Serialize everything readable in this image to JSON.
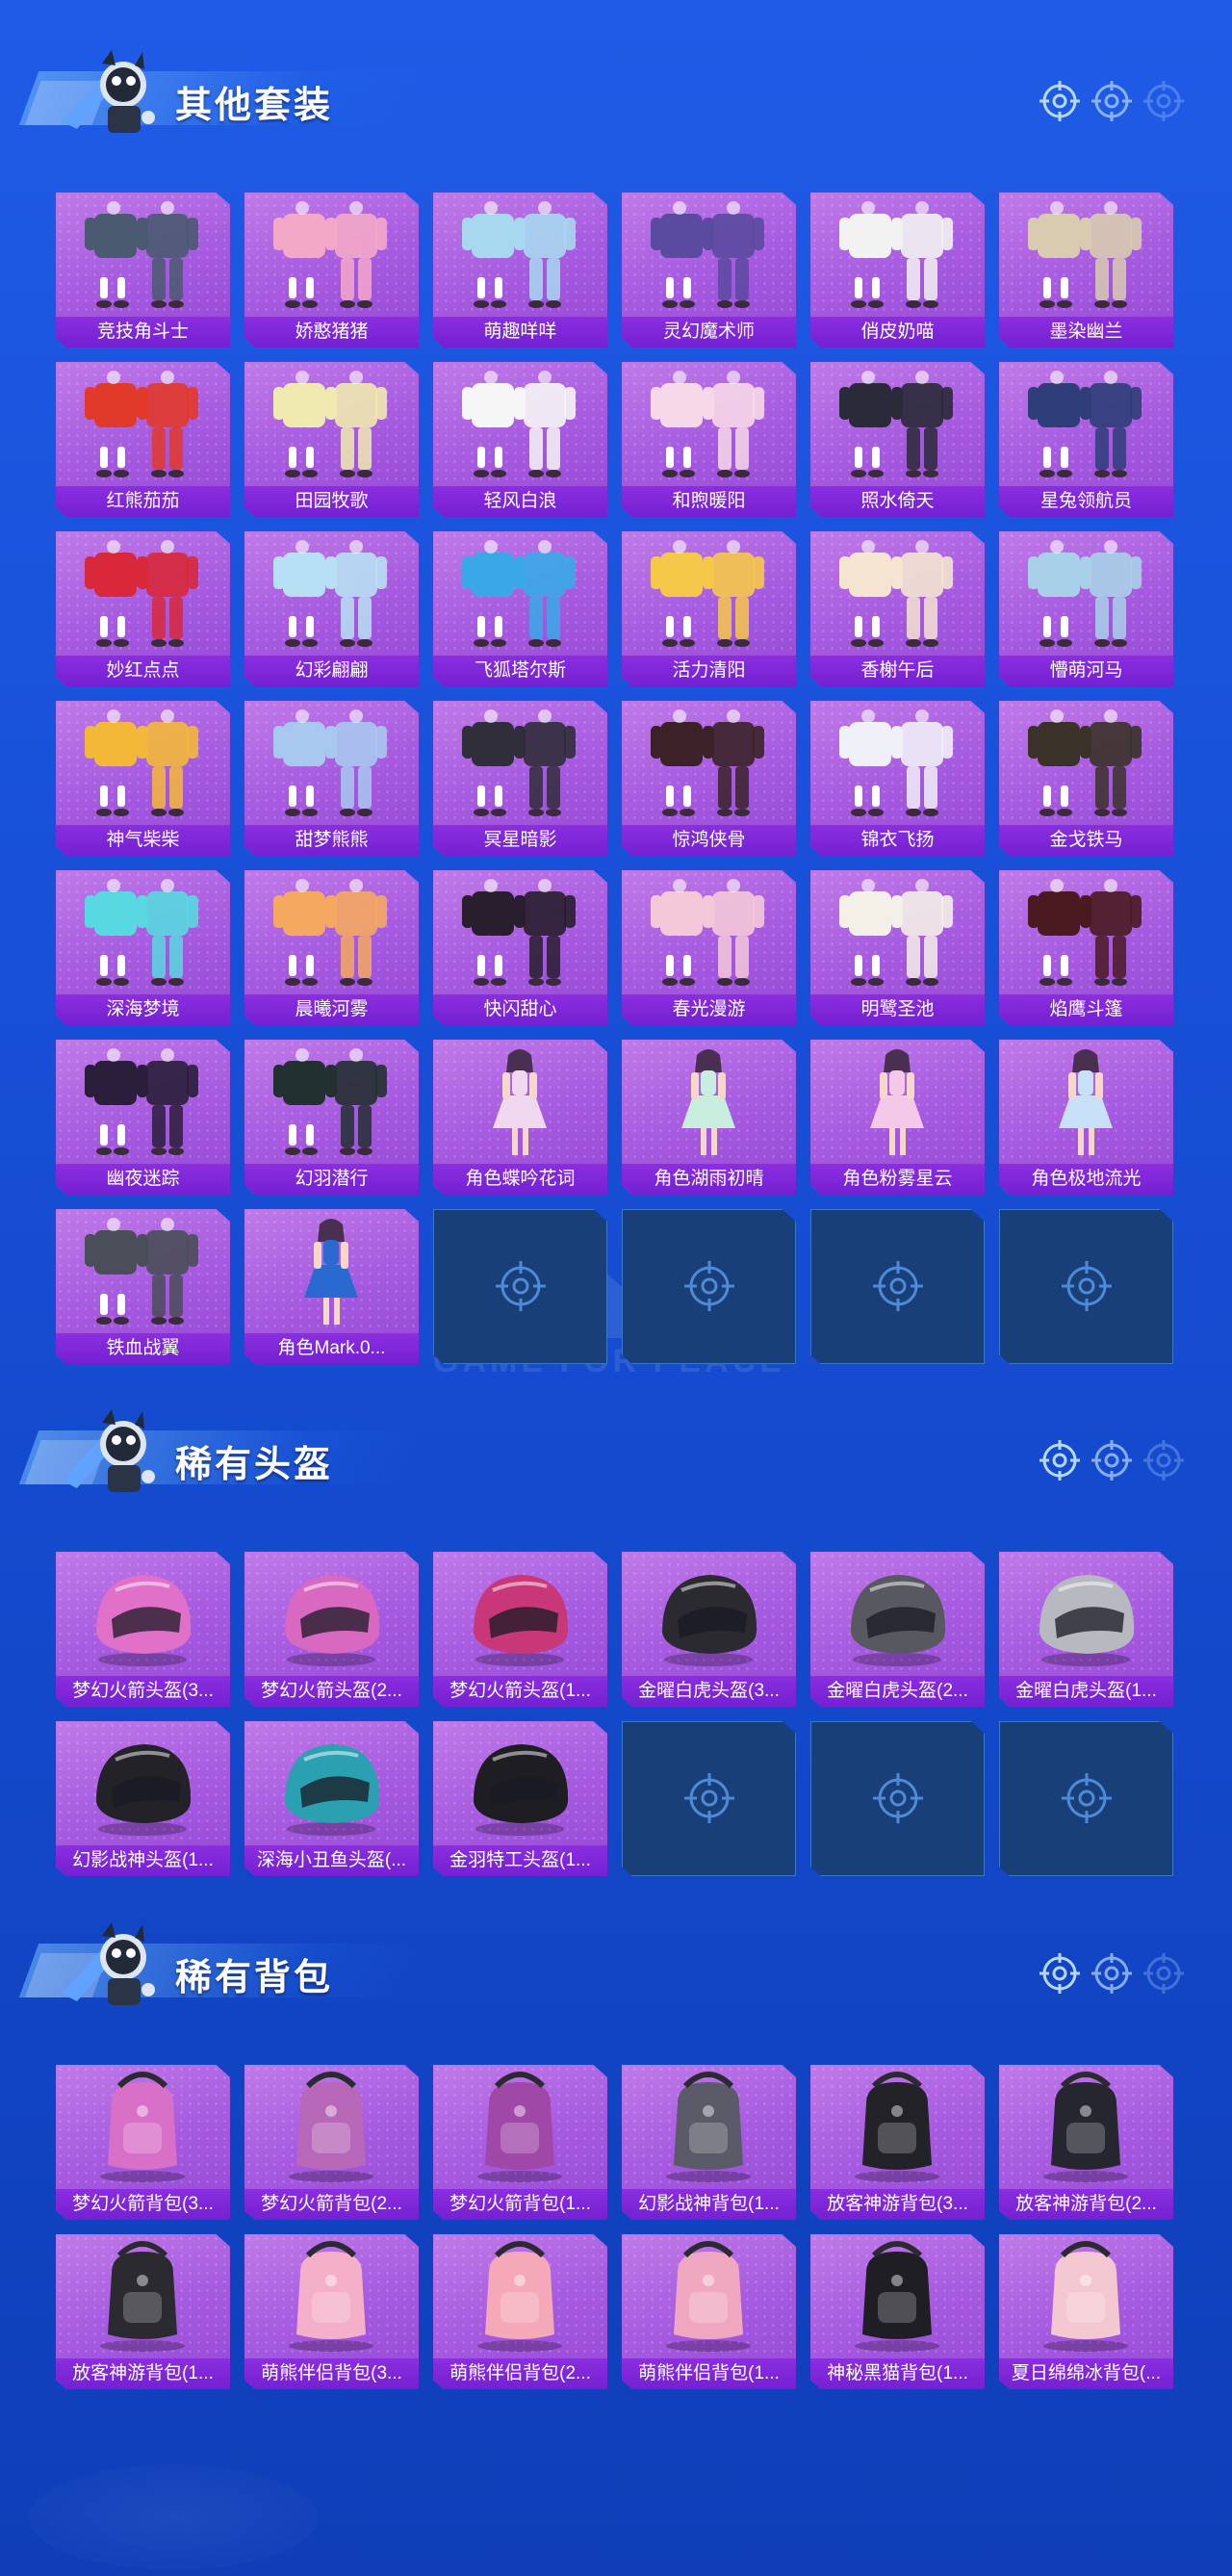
{
  "colors": {
    "background": "#1a52dc",
    "tile": "#a75be0",
    "label": "#7a24d6",
    "empty_tile": "#193f78"
  },
  "sections": [
    {
      "title": "其他套装",
      "items": [
        {
          "label": "竞技角斗士",
          "kind": "outfit",
          "color": "#4a5a70"
        },
        {
          "label": "娇憨猪猪",
          "kind": "outfit",
          "color": "#f4a8c8"
        },
        {
          "label": "萌趣咩咩",
          "kind": "outfit",
          "color": "#a8d8f0"
        },
        {
          "label": "灵幻魔术师",
          "kind": "outfit",
          "color": "#5a4aa0"
        },
        {
          "label": "俏皮奶喵",
          "kind": "outfit",
          "color": "#f2f2f2"
        },
        {
          "label": "墨染幽兰",
          "kind": "outfit",
          "color": "#d8cbb0"
        },
        {
          "label": "红熊茄茄",
          "kind": "outfit",
          "color": "#e23a2a"
        },
        {
          "label": "田园牧歌",
          "kind": "outfit",
          "color": "#f0eab0"
        },
        {
          "label": "轻风白浪",
          "kind": "outfit",
          "color": "#f6f6f6"
        },
        {
          "label": "和煦暖阳",
          "kind": "outfit",
          "color": "#f7d8e8"
        },
        {
          "label": "照水倚天",
          "kind": "outfit",
          "color": "#2a2a38"
        },
        {
          "label": "星兔领航员",
          "kind": "outfit",
          "color": "#2d3e78"
        },
        {
          "label": "妙红点点",
          "kind": "outfit",
          "color": "#d8283a"
        },
        {
          "label": "幻彩翩翩",
          "kind": "outfit",
          "color": "#b8e0f4"
        },
        {
          "label": "飞狐塔尔斯",
          "kind": "outfit",
          "color": "#3aa8e8"
        },
        {
          "label": "活力清阳",
          "kind": "outfit",
          "color": "#f6c84a"
        },
        {
          "label": "香榭午后",
          "kind": "outfit",
          "color": "#f4e4d0"
        },
        {
          "label": "懵萌河马",
          "kind": "outfit",
          "color": "#a8d0e8"
        },
        {
          "label": "神气柴柴",
          "kind": "outfit",
          "color": "#f4b838"
        },
        {
          "label": "甜梦熊熊",
          "kind": "outfit",
          "color": "#a8c8f0"
        },
        {
          "label": "冥星暗影",
          "kind": "outfit",
          "color": "#302e3a"
        },
        {
          "label": "惊鸿侠骨",
          "kind": "outfit",
          "color": "#3a2228"
        },
        {
          "label": "锦衣飞扬",
          "kind": "outfit",
          "color": "#f0f0f8"
        },
        {
          "label": "金戈铁马",
          "kind": "outfit",
          "color": "#3a3228"
        },
        {
          "label": "深海梦境",
          "kind": "outfit",
          "color": "#58d8e0"
        },
        {
          "label": "晨曦河雾",
          "kind": "outfit",
          "color": "#f4a860"
        },
        {
          "label": "快闪甜心",
          "kind": "outfit",
          "color": "#281e2e"
        },
        {
          "label": "春光漫游",
          "kind": "outfit",
          "color": "#f4c8d8"
        },
        {
          "label": "明鹭圣池",
          "kind": "outfit",
          "color": "#f4f0e8"
        },
        {
          "label": "焰鹰斗篷",
          "kind": "outfit",
          "color": "#4a1a20"
        },
        {
          "label": "幽夜迷踪",
          "kind": "outfit",
          "color": "#2a1e3a"
        },
        {
          "label": "幻羽潜行",
          "kind": "outfit",
          "color": "#223030"
        },
        {
          "label": "角色蝶吟花词",
          "kind": "character",
          "color": "#f0d8f0"
        },
        {
          "label": "角色湖雨初晴",
          "kind": "character",
          "color": "#c8eee0"
        },
        {
          "label": "角色粉雾星云",
          "kind": "character",
          "color": "#f4c8e8"
        },
        {
          "label": "角色极地流光",
          "kind": "character",
          "color": "#c8e0f8"
        },
        {
          "label": "铁血战翼",
          "kind": "outfit",
          "color": "#4a4e58"
        },
        {
          "label": "角色Mark.0...",
          "kind": "character",
          "color": "#2a6ad0"
        },
        {
          "empty": true
        },
        {
          "empty": true
        },
        {
          "empty": true
        },
        {
          "empty": true
        }
      ]
    },
    {
      "title": "稀有头盔",
      "items": [
        {
          "label": "梦幻火箭头盔(3...",
          "kind": "helmet",
          "color": "#e070c8"
        },
        {
          "label": "梦幻火箭头盔(2...",
          "kind": "helmet",
          "color": "#d868c0"
        },
        {
          "label": "梦幻火箭头盔(1...",
          "kind": "helmet",
          "color": "#c83878"
        },
        {
          "label": "金曜白虎头盔(3...",
          "kind": "helmet",
          "color": "#2a2a30"
        },
        {
          "label": "金曜白虎头盔(2...",
          "kind": "helmet",
          "color": "#585860"
        },
        {
          "label": "金曜白虎头盔(1...",
          "kind": "helmet",
          "color": "#b8b8c0"
        },
        {
          "label": "幻影战神头盔(1...",
          "kind": "helmet",
          "color": "#222228"
        },
        {
          "label": "深海小丑鱼头盔(...",
          "kind": "helmet",
          "color": "#2aa0b0"
        },
        {
          "label": "金羽特工头盔(1...",
          "kind": "helmet",
          "color": "#1e1e22"
        },
        {
          "empty": true
        },
        {
          "empty": true
        },
        {
          "empty": true
        }
      ]
    },
    {
      "title": "稀有背包",
      "items": [
        {
          "label": "梦幻火箭背包(3...",
          "kind": "backpack",
          "color": "#d870c8"
        },
        {
          "label": "梦幻火箭背包(2...",
          "kind": "backpack",
          "color": "#b868b8"
        },
        {
          "label": "梦幻火箭背包(1...",
          "kind": "backpack",
          "color": "#a048a8"
        },
        {
          "label": "幻影战神背包(1...",
          "kind": "backpack",
          "color": "#5a5a68"
        },
        {
          "label": "放客神游背包(3...",
          "kind": "backpack",
          "color": "#222228"
        },
        {
          "label": "放客神游背包(2...",
          "kind": "backpack",
          "color": "#262630"
        },
        {
          "label": "放客神游背包(1...",
          "kind": "backpack",
          "color": "#2a2a30"
        },
        {
          "label": "萌熊伴侣背包(3...",
          "kind": "backpack",
          "color": "#f4b0c8"
        },
        {
          "label": "萌熊伴侣背包(2...",
          "kind": "backpack",
          "color": "#f4a8b8"
        },
        {
          "label": "萌熊伴侣背包(1...",
          "kind": "backpack",
          "color": "#f0a8c0"
        },
        {
          "label": "神秘黑猫背包(1...",
          "kind": "backpack",
          "color": "#1e1e24"
        },
        {
          "label": "夏日绵绵冰背包(...",
          "kind": "backpack",
          "color": "#f4c8d0"
        }
      ]
    }
  ],
  "watermark": "GAME FOR PEACE"
}
